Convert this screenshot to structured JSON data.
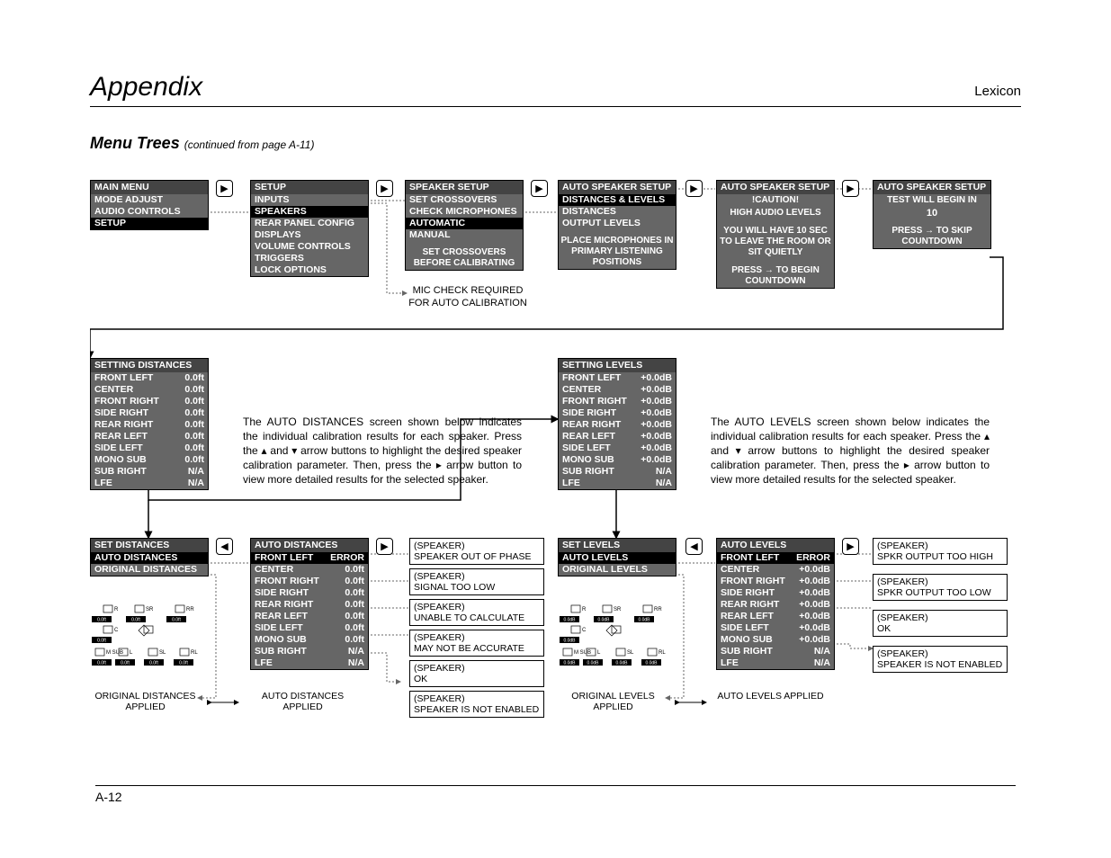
{
  "header": {
    "left": "Appendix",
    "right": "Lexicon"
  },
  "subtitle": {
    "main": "Menu Trees",
    "cont": "(continued from page A-11)"
  },
  "footer": "A-12",
  "row1": {
    "c1": {
      "title": "MAIN MENU",
      "items": [
        "MODE ADJUST",
        "AUDIO CONTROLS",
        "SETUP"
      ],
      "sel": 2
    },
    "c2": {
      "title": "SETUP",
      "items": [
        "INPUTS",
        "SPEAKERS",
        "REAR PANEL CONFIG",
        "DISPLAYS",
        "VOLUME CONTROLS",
        "TRIGGERS",
        "LOCK OPTIONS"
      ],
      "sel": 1
    },
    "c3": {
      "title": "SPEAKER SETUP",
      "items": [
        "SET CROSSOVERS",
        "CHECK MICROPHONES",
        "AUTOMATIC",
        "MANUAL"
      ],
      "sel": 2,
      "msg": "SET CROSSOVERS BEFORE CALIBRATING"
    },
    "c4": {
      "title": "AUTO SPEAKER SETUP",
      "items": [
        "DISTANCES & LEVELS",
        "DISTANCES",
        "OUTPUT LEVELS"
      ],
      "sel": 0,
      "msg": "PLACE MICROPHONES IN PRIMARY LISTENING POSITIONS"
    },
    "c5": {
      "title": "AUTO SPEAKER SETUP",
      "msg1": "!CAUTION!",
      "msg2": "HIGH AUDIO LEVELS",
      "msg3": "YOU WILL HAVE 10 SEC TO LEAVE THE ROOM OR SIT QUIETLY",
      "msg4": "PRESS → TO BEGIN COUNTDOWN"
    },
    "c6": {
      "title": "AUTO SPEAKER SETUP",
      "msg1": "TEST WILL BEGIN IN",
      "msg2": "10",
      "msg3": "PRESS → TO SKIP COUNTDOWN"
    }
  },
  "note1": "MIC CHECK REQUIRED FOR AUTO CALIBRATION",
  "settingDistances": {
    "title": "SETTING DISTANCES",
    "rows": [
      [
        "FRONT LEFT",
        "0.0ft"
      ],
      [
        "CENTER",
        "0.0ft"
      ],
      [
        "FRONT RIGHT",
        "0.0ft"
      ],
      [
        "SIDE RIGHT",
        "0.0ft"
      ],
      [
        "REAR RIGHT",
        "0.0ft"
      ],
      [
        "REAR LEFT",
        "0.0ft"
      ],
      [
        "SIDE LEFT",
        "0.0ft"
      ],
      [
        "MONO SUB",
        "0.0ft"
      ],
      [
        "SUB RIGHT",
        "N/A"
      ],
      [
        "LFE",
        "N/A"
      ]
    ]
  },
  "settingLevels": {
    "title": "SETTING LEVELS",
    "rows": [
      [
        "FRONT LEFT",
        "+0.0dB"
      ],
      [
        "CENTER",
        "+0.0dB"
      ],
      [
        "FRONT RIGHT",
        "+0.0dB"
      ],
      [
        "SIDE RIGHT",
        "+0.0dB"
      ],
      [
        "REAR RIGHT",
        "+0.0dB"
      ],
      [
        "REAR LEFT",
        "+0.0dB"
      ],
      [
        "SIDE LEFT",
        "+0.0dB"
      ],
      [
        "MONO SUB",
        "+0.0dB"
      ],
      [
        "SUB RIGHT",
        "N/A"
      ],
      [
        "LFE",
        "N/A"
      ]
    ]
  },
  "bodyDist": "The AUTO DISTANCES screen shown below indicates the individual calibration results for each speaker. Press the ▴ and ▾ arrow buttons to highlight the desired speaker calibration parameter. Then, press the ▸ arrow button to view more detailed results for the selected speaker.",
  "bodyLev": "The AUTO LEVELS screen shown below indicates the individual calibration results for each speaker. Press the ▴ and ▾ arrow buttons to highlight the desired speaker calibration parameter. Then, press the ▸ arrow button to view more detailed results for the selected speaker.",
  "setDistances": {
    "title": "SET DISTANCES",
    "items": [
      "AUTO DISTANCES",
      "ORIGINAL DISTANCES"
    ],
    "sel": 0
  },
  "autoDistances": {
    "title": "AUTO DISTANCES",
    "rows": [
      [
        "FRONT LEFT",
        "ERROR"
      ],
      [
        "CENTER",
        "0.0ft"
      ],
      [
        "FRONT RIGHT",
        "0.0ft"
      ],
      [
        "SIDE RIGHT",
        "0.0ft"
      ],
      [
        "REAR RIGHT",
        "0.0ft"
      ],
      [
        "REAR LEFT",
        "0.0ft"
      ],
      [
        "SIDE LEFT",
        "0.0ft"
      ],
      [
        "MONO SUB",
        "0.0ft"
      ],
      [
        "SUB RIGHT",
        "N/A"
      ],
      [
        "LFE",
        "N/A"
      ]
    ],
    "sel": 0
  },
  "distErrors": [
    "(SPEAKER)\nSPEAKER OUT OF PHASE",
    "(SPEAKER)\nSIGNAL TOO LOW",
    "(SPEAKER)\nUNABLE TO CALCULATE",
    "(SPEAKER)\nMAY NOT BE ACCURATE",
    "(SPEAKER)\nOK",
    "(SPEAKER)\nSPEAKER IS NOT ENABLED"
  ],
  "setLevels": {
    "title": "SET LEVELS",
    "items": [
      "AUTO LEVELS",
      "ORIGINAL LEVELS"
    ],
    "sel": 0
  },
  "autoLevels": {
    "title": "AUTO LEVELS",
    "rows": [
      [
        "FRONT LEFT",
        "ERROR"
      ],
      [
        "CENTER",
        "+0.0dB"
      ],
      [
        "FRONT RIGHT",
        "+0.0dB"
      ],
      [
        "SIDE RIGHT",
        "+0.0dB"
      ],
      [
        "REAR RIGHT",
        "+0.0dB"
      ],
      [
        "REAR LEFT",
        "+0.0dB"
      ],
      [
        "SIDE LEFT",
        "+0.0dB"
      ],
      [
        "MONO SUB",
        "+0.0dB"
      ],
      [
        "SUB RIGHT",
        "N/A"
      ],
      [
        "LFE",
        "N/A"
      ]
    ],
    "sel": 0
  },
  "levErrors": [
    "(SPEAKER)\nSPKR OUTPUT TOO HIGH",
    "(SPEAKER)\nSPKR OUTPUT TOO LOW",
    "(SPEAKER)\nOK",
    "(SPEAKER)\nSPEAKER IS NOT ENABLED"
  ],
  "applied": {
    "origDist": "ORIGINAL DISTANCES APPLIED",
    "autoDist": "AUTO DISTANCES APPLIED",
    "origLev": "ORIGINAL LEVELS APPLIED",
    "autoLev": "AUTO LEVELS APPLIED"
  },
  "speakerLabels": {
    "r": "R",
    "sr": "SR",
    "rr": "RR",
    "c": "C",
    "m_sub": "M SUB",
    "l": "L",
    "sl": "SL",
    "rl": "RL",
    "distVal": "0.0ft",
    "levVal": "0.0dB"
  }
}
